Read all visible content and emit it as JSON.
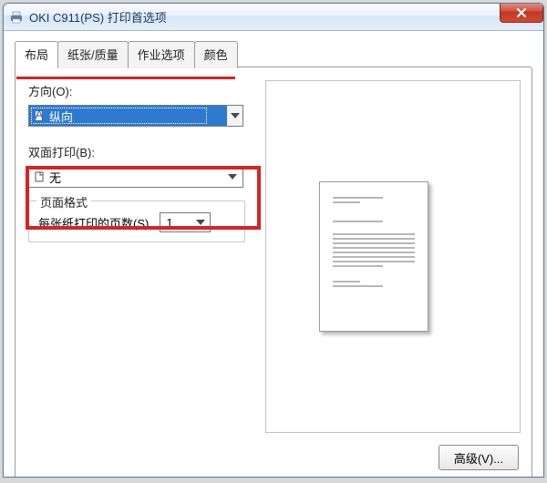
{
  "window": {
    "title": "OKI C911(PS) 打印首选项"
  },
  "tabs": [
    {
      "label": "布局",
      "active": true
    },
    {
      "label": "纸张/质量",
      "active": false
    },
    {
      "label": "作业选项",
      "active": false
    },
    {
      "label": "颜色",
      "active": false
    }
  ],
  "orientation": {
    "label": "方向(O):",
    "value": "纵向",
    "icon": "portrait-doc-icon"
  },
  "duplex": {
    "label": "双面打印(B):",
    "value": "无",
    "icon": "doc-icon"
  },
  "page_format": {
    "legend": "页面格式",
    "pages_per_sheet_label": "每张纸打印的页数(S)",
    "pages_per_sheet_value": "1"
  },
  "buttons": {
    "advanced": "高级(V)..."
  }
}
